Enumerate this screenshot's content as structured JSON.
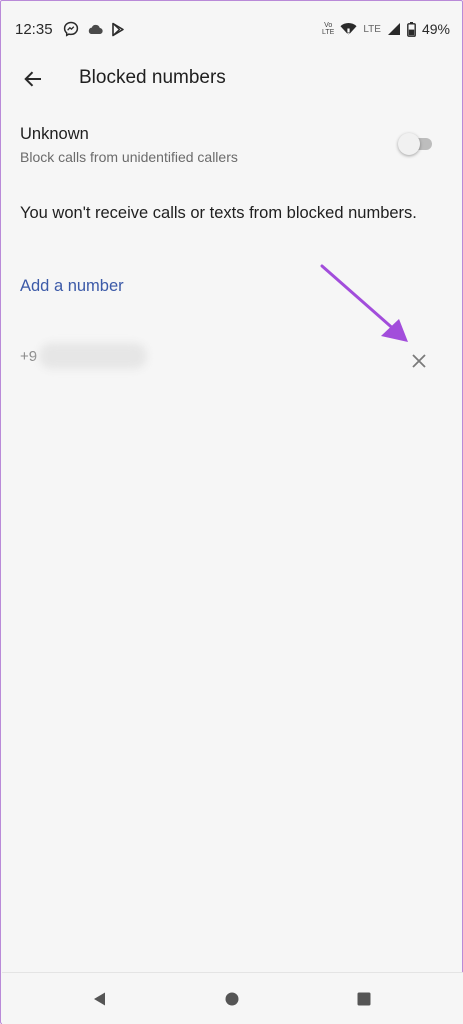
{
  "status_bar": {
    "time": "12:35",
    "battery": "49%",
    "volte_line1": "Vo",
    "volte_line2": "LTE",
    "lte": "LTE"
  },
  "app_bar": {
    "title": "Blocked numbers"
  },
  "unknown_setting": {
    "title": "Unknown",
    "subtitle": "Block calls from unidentified callers",
    "enabled": false
  },
  "info_text": "You won't receive calls or texts from blocked numbers.",
  "add_number_label": "Add a number",
  "blocked_list": [
    {
      "number_prefix": "+9"
    }
  ],
  "colors": {
    "accent_link": "#3c5aa8",
    "annotation_arrow": "#a24ddb",
    "background": "#f6f6f6"
  }
}
